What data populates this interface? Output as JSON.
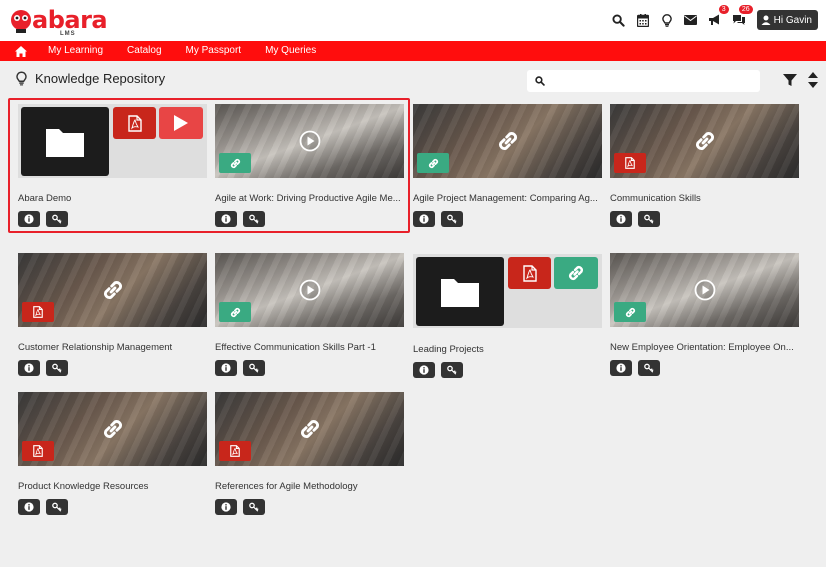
{
  "header": {
    "logo_text": "abara",
    "logo_sub": "LMS",
    "notifications_count": "3",
    "messages_count": "26",
    "user_greeting": "Hi Gavin"
  },
  "nav": {
    "items": [
      "My Learning",
      "Catalog",
      "My Passport",
      "My Queries"
    ]
  },
  "page": {
    "title": "Knowledge Repository",
    "search_placeholder": "",
    "search_value": ""
  },
  "cards": [
    {
      "title": "Abara Demo",
      "type": "collection",
      "parts": [
        "folder",
        "pdf",
        "video"
      ],
      "selected": true
    },
    {
      "title": "Agile at Work: Driving Productive Agile Me...",
      "type": "video-link",
      "tag": "link"
    },
    {
      "title": "Agile Project Management: Comparing Ag...",
      "type": "link",
      "tag": "link"
    },
    {
      "title": "Communication Skills",
      "type": "link",
      "tag": "pdf"
    },
    {
      "title": "Customer Relationship Management",
      "type": "link",
      "tag": "pdf"
    },
    {
      "title": "Effective Communication Skills Part -1",
      "type": "video-link",
      "tag": "link"
    },
    {
      "title": "Leading Projects",
      "type": "collection",
      "parts": [
        "folder",
        "pdf",
        "link"
      ]
    },
    {
      "title": "New Employee Orientation: Employee On...",
      "type": "video-link",
      "tag": "link"
    },
    {
      "title": "Product Knowledge Resources",
      "type": "link",
      "tag": "pdf"
    },
    {
      "title": "References for Agile Methodology",
      "type": "link",
      "tag": "pdf"
    }
  ],
  "colors": {
    "brand_red": "#ff0d0d",
    "pdf_red": "#c8261b",
    "link_teal": "#3aaa82",
    "dark": "#333333"
  }
}
